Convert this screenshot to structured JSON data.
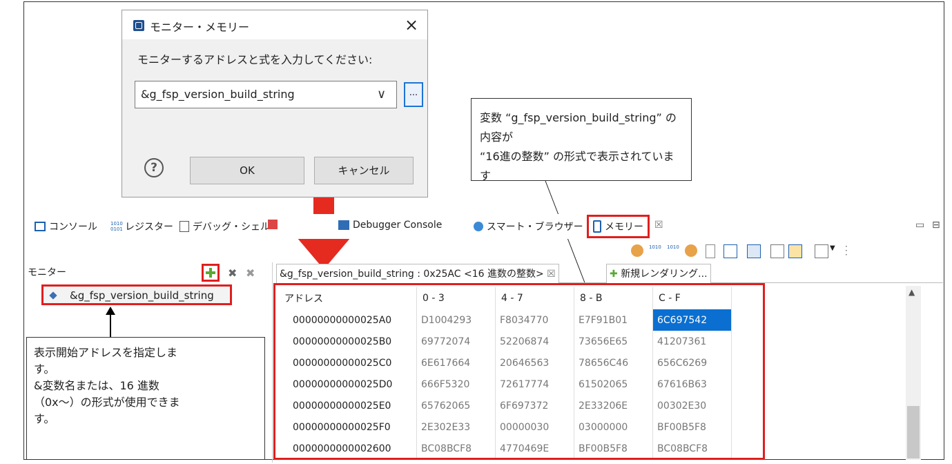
{
  "dialog": {
    "title": "モニター・メモリー",
    "close": "×",
    "prompt": "モニターするアドレスと式を入力してください:",
    "input_value": "&g_fsp_version_build_string",
    "dropdown_arrow": "∨",
    "browse_label": "...",
    "help": "?",
    "ok_label": "OK",
    "cancel_label": "キャンセル"
  },
  "callout": {
    "line1": "変数 “g_fsp_version_build_string” の内容が",
    "line2": "“16進の整数” の形式で表示されています"
  },
  "tabs": [
    {
      "label": "コンソール"
    },
    {
      "label": "レジスター"
    },
    {
      "label": "デバッグ・シェル"
    },
    {
      "label": "Debugger Console"
    },
    {
      "label": "スマート・ブラウザー"
    },
    {
      "label": "メモリー"
    }
  ],
  "memory_tab_close": "☒",
  "monitor": {
    "label": "モニター",
    "item": "&g_fsp_version_build_string"
  },
  "rendering_tabs": {
    "active": "&g_fsp_version_build_string : 0x25AC <16 進数の整数>",
    "new": "新規レンダリング..."
  },
  "table": {
    "headers": [
      "アドレス",
      "0 - 3",
      "4 - 7",
      "8 - B",
      "C - F"
    ],
    "rows": [
      [
        "00000000000025A0",
        "D1004293",
        "F8034770",
        "E7F91B01",
        "6C697542"
      ],
      [
        "00000000000025B0",
        "69772074",
        "52206874",
        "73656E65",
        "41207361"
      ],
      [
        "00000000000025C0",
        "6E617664",
        "20646563",
        "78656C46",
        "656C6269"
      ],
      [
        "00000000000025D0",
        "666F5320",
        "72617774",
        "61502065",
        "67616B63"
      ],
      [
        "00000000000025E0",
        "65762065",
        "6F697372",
        "2E33206E",
        "00302E30"
      ],
      [
        "00000000000025F0",
        "2E302E33",
        "00000030",
        "03000000",
        "BF00B5F8"
      ],
      [
        "0000000000002600",
        "BC08BCF8",
        "4770469E",
        "BF00B5F8",
        "BC08BCF8"
      ]
    ]
  },
  "note": {
    "line1": "表示開始アドレスを指定しま",
    "line2": "す。",
    "line3": "&変数名または、16 進数",
    "line4": "（0x～）の形式が使用できま",
    "line5": "す。"
  },
  "colors": {
    "highlight": "#e01e1e",
    "arrow": "#e52a20",
    "selected_cell": "#0a6fd1"
  }
}
